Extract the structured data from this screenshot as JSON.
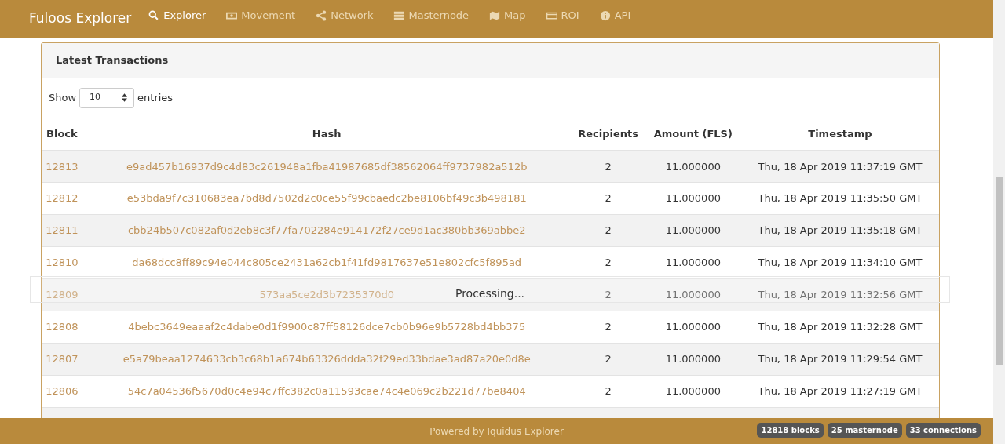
{
  "navbar": {
    "brand": "Fuloos Explorer",
    "items": [
      {
        "label": "Explorer",
        "kind": "search",
        "selected": true
      },
      {
        "label": "Movement",
        "kind": "bill",
        "selected": false
      },
      {
        "label": "Network",
        "kind": "share",
        "selected": false
      },
      {
        "label": "Masternode",
        "kind": "server",
        "selected": false
      },
      {
        "label": "Map",
        "kind": "map",
        "selected": false
      },
      {
        "label": "ROI",
        "kind": "card",
        "selected": false
      },
      {
        "label": "API",
        "kind": "info",
        "selected": false
      }
    ]
  },
  "panel": {
    "title": "Latest Transactions",
    "length_label_before": "Show",
    "length_value": "10",
    "length_label_after": "entries",
    "table": {
      "columns": [
        "Block",
        "Hash",
        "Recipients",
        "Amount (FLS)",
        "Timestamp"
      ],
      "rows": [
        {
          "block": "12813",
          "hash": "e9ad457b16937d9c4d83c261948a1fba41987685df38562064ff9737982a512b",
          "recipients": "2",
          "amount": "11.000000",
          "timestamp": "Thu, 18 Apr 2019 11:37:19 GMT"
        },
        {
          "block": "12812",
          "hash": "e53bda9f7c310683ea7bd8d7502d2c0ce55f99cbaedc2be8106bf49c3b498181",
          "recipients": "2",
          "amount": "11.000000",
          "timestamp": "Thu, 18 Apr 2019 11:35:50 GMT"
        },
        {
          "block": "12811",
          "hash": "cbb24b507c082af0d2eb8c3f77fa702284e914172f27ce9d1ac380bb369abbe2",
          "recipients": "2",
          "amount": "11.000000",
          "timestamp": "Thu, 18 Apr 2019 11:35:18 GMT"
        },
        {
          "block": "12810",
          "hash": "da68dcc8ff89c94e044c805ce2431a62cb1f41fd9817637e51e802cfc5f895ad",
          "recipients": "2",
          "amount": "11.000000",
          "timestamp": "Thu, 18 Apr 2019 11:34:10 GMT"
        },
        {
          "block": "12809",
          "hash": "573aa5ce2d3b7235370d0",
          "recipients": "2",
          "amount": "11.000000",
          "timestamp": "Thu, 18 Apr 2019 11:32:56 GMT",
          "obscured": true
        },
        {
          "block": "12808",
          "hash": "4bebc3649eaaaf2c4dabe0d1f9900c87ff58126dce7cb0b96e9b5728bd4bb375",
          "recipients": "2",
          "amount": "11.000000",
          "timestamp": "Thu, 18 Apr 2019 11:32:28 GMT"
        },
        {
          "block": "12807",
          "hash": "e5a79beaa1274633cb3c68b1a674b63326ddda32f29ed33bdae3ad87a20e0d8e",
          "recipients": "2",
          "amount": "11.000000",
          "timestamp": "Thu, 18 Apr 2019 11:29:54 GMT"
        },
        {
          "block": "12806",
          "hash": "54c7a04536f5670d0c4e94c7ffc382c0a11593cae74c4e069c2b221d77be8404",
          "recipients": "2",
          "amount": "11.000000",
          "timestamp": "Thu, 18 Apr 2019 11:27:19 GMT"
        }
      ]
    },
    "processing": {
      "text": "Processing..."
    }
  },
  "footer": {
    "text": "Powered by Iquidus Explorer",
    "badges": [
      "12818 blocks",
      "25 masternode",
      "33 connections"
    ]
  }
}
